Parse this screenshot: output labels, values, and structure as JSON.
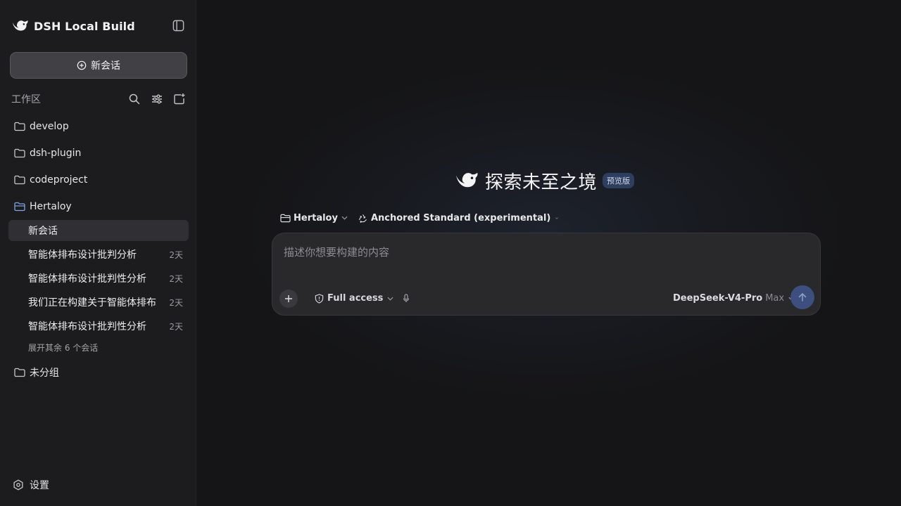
{
  "app": {
    "title": "DSH Local Build"
  },
  "sidebar": {
    "new_chat_label": "新会话",
    "workspace_title": "工作区",
    "folders": [
      {
        "label": "develop"
      },
      {
        "label": "dsh-plugin"
      },
      {
        "label": "codeproject"
      },
      {
        "label": "Hertaloy",
        "expanded": true
      },
      {
        "label": "未分组"
      }
    ],
    "conversations": [
      {
        "title": "新会话",
        "age": "",
        "active": true
      },
      {
        "title": "智能体排布设计批判分析",
        "age": "2天"
      },
      {
        "title": "智能体排布设计批判性分析",
        "age": "2天"
      },
      {
        "title": "我们正在构建关于智能体排布",
        "age": "2天"
      },
      {
        "title": "智能体排布设计批判性分析",
        "age": "2天"
      }
    ],
    "expand_more": "展开其余 6 个会话",
    "settings_label": "设置"
  },
  "main": {
    "headline": "探索未至之境",
    "badge": "预览版",
    "context": {
      "folder": "Hertaloy",
      "mode": "Anchored Standard (experimental)"
    },
    "composer": {
      "placeholder": "描述你想要构建的内容",
      "value": "",
      "access": "Full access",
      "model_name": "DeepSeek-V4-Pro",
      "model_tier": "Max"
    }
  },
  "colors": {
    "sidebar_bg": "#1c1c1e",
    "main_bg": "#151517",
    "composer_bg": "#29292c",
    "accent": "#3d4f7e",
    "badge_bg": "#2d3e5e"
  }
}
